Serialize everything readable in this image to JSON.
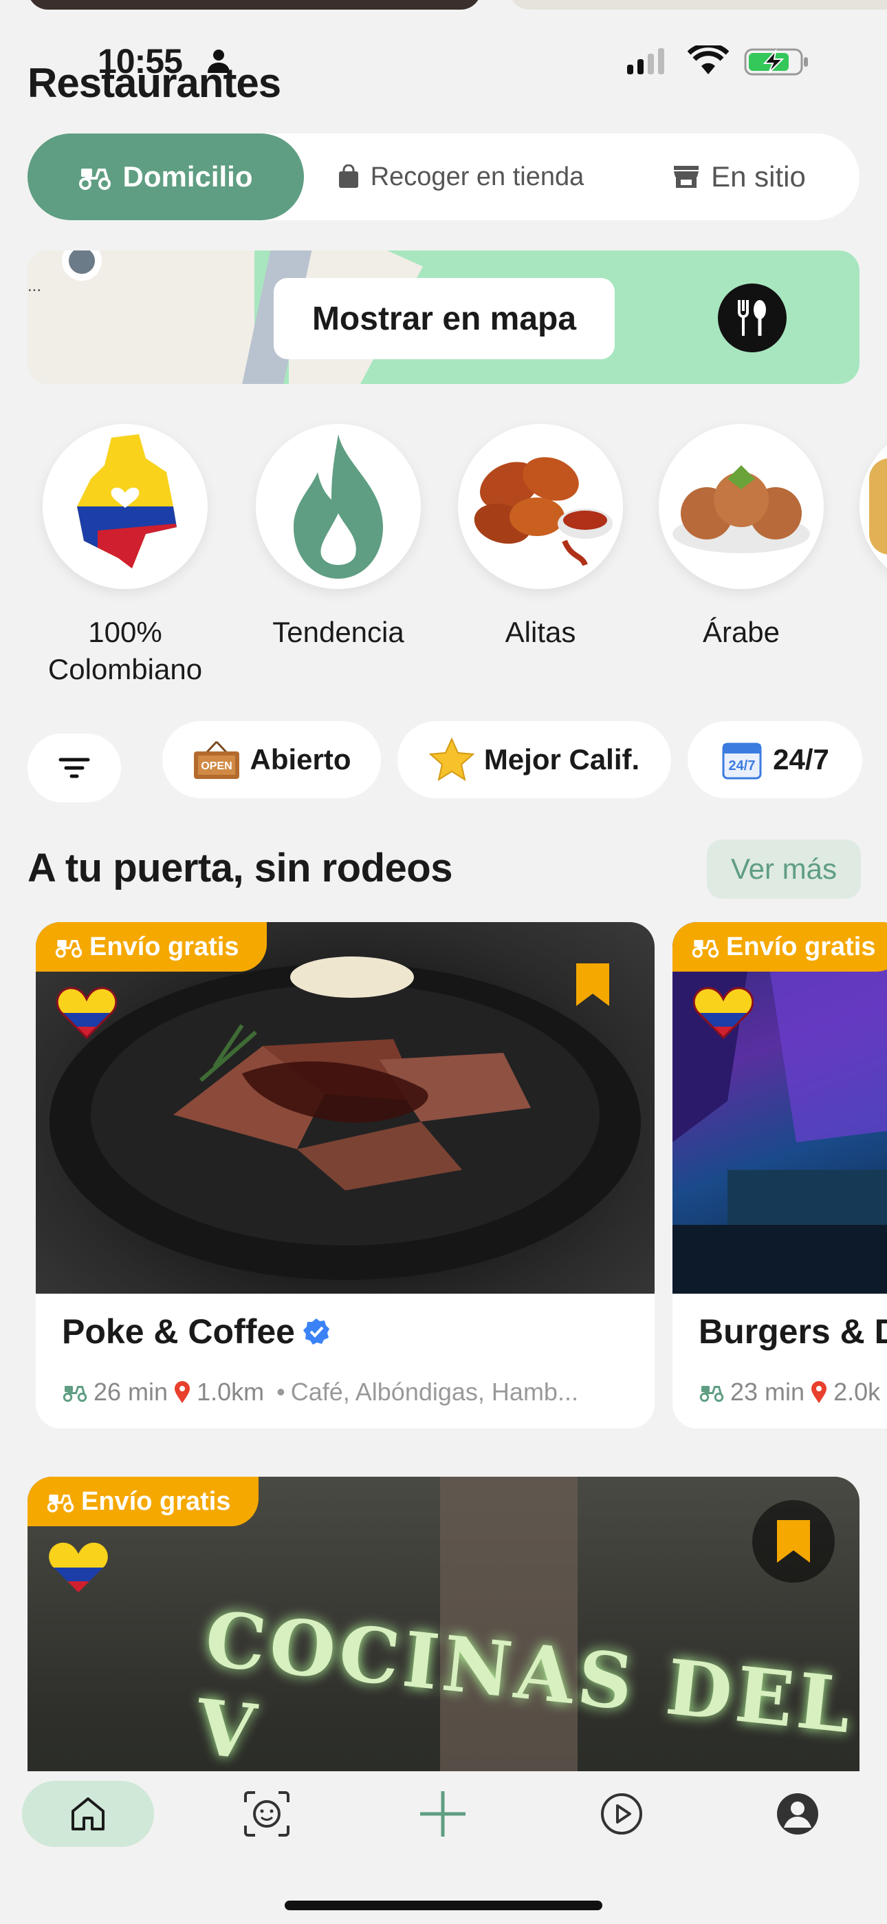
{
  "status": {
    "time": "10:55"
  },
  "page": {
    "title": "Restaurantes"
  },
  "modes": [
    {
      "label": "Domicilio",
      "icon": "scooter-icon",
      "active": true
    },
    {
      "label": "Recoger en tienda",
      "icon": "bag-icon",
      "active": false
    },
    {
      "label": "En sitio",
      "icon": "store-icon",
      "active": false
    }
  ],
  "map_banner": {
    "button_label": "Mostrar en mapa"
  },
  "categories": [
    {
      "label": "100% Colombiano",
      "line1": "100%",
      "line2": "Colombiano",
      "icon": "colombia-map-icon"
    },
    {
      "label": "Tendencia",
      "icon": "flame-icon"
    },
    {
      "label": "Alitas",
      "icon": "chicken-wings-icon"
    },
    {
      "label": "Árabe",
      "icon": "falafel-icon"
    }
  ],
  "filters": [
    {
      "label": "Abierto",
      "icon": "open-sign-icon"
    },
    {
      "label": "Mejor Calif.",
      "icon": "star-icon"
    },
    {
      "label": "24/7",
      "icon": "calendar-icon"
    }
  ],
  "section": {
    "title": "A tu puerta, sin rodeos",
    "more_label": "Ver más"
  },
  "restaurants": [
    {
      "badge": "Envío gratis",
      "name": "Poke & Coffee",
      "verified": true,
      "time": "26 min",
      "distance": "1.0km",
      "tags": "Café, Albóndigas, Hamb..."
    },
    {
      "badge": "Envío gratis",
      "name": "Burgers & D",
      "verified": false,
      "time": "23 min",
      "distance": "2.0k",
      "tags": ""
    },
    {
      "badge": "Envío gratis",
      "name": "",
      "sign_text": "COCINAS DEL V"
    }
  ],
  "colors": {
    "primary": "#5f9e82",
    "badge": "#f5a800",
    "background": "#f2f2f2"
  }
}
